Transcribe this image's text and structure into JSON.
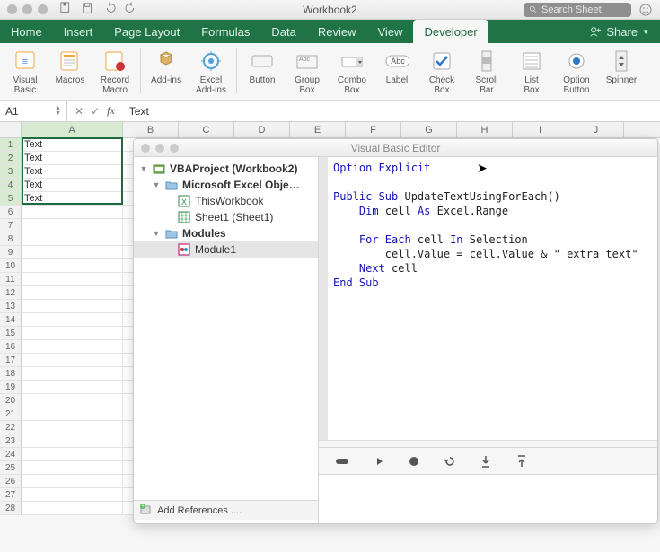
{
  "window": {
    "title": "Workbook2",
    "search_placeholder": "Search Sheet",
    "share_label": "Share"
  },
  "tabs": [
    {
      "label": "Home"
    },
    {
      "label": "Insert"
    },
    {
      "label": "Page Layout"
    },
    {
      "label": "Formulas"
    },
    {
      "label": "Data"
    },
    {
      "label": "Review"
    },
    {
      "label": "View"
    },
    {
      "label": "Developer",
      "active": true
    }
  ],
  "ribbon": {
    "visual_basic": "Visual\nBasic",
    "macros": "Macros",
    "record_macro": "Record\nMacro",
    "addins": "Add-ins",
    "excel_addins": "Excel\nAdd-ins",
    "button": "Button",
    "group_box": "Group\nBox",
    "combo_box": "Combo\nBox",
    "label": "Label",
    "check_box": "Check\nBox",
    "scroll_bar": "Scroll\nBar",
    "list_box": "List\nBox",
    "option_button": "Option\nButton",
    "spinner": "Spinner"
  },
  "formula_bar": {
    "name_box": "A1",
    "fx": "fx",
    "content": "Text"
  },
  "grid": {
    "columns": [
      "A",
      "B",
      "C",
      "D",
      "E",
      "F",
      "G",
      "H",
      "I",
      "J"
    ],
    "col_widths": {
      "A": 113
    },
    "rows": [
      {
        "n": 1,
        "cells": [
          "Text"
        ]
      },
      {
        "n": 2,
        "cells": [
          "Text"
        ]
      },
      {
        "n": 3,
        "cells": [
          "Text"
        ]
      },
      {
        "n": 4,
        "cells": [
          "Text"
        ]
      },
      {
        "n": 5,
        "cells": [
          "Text"
        ]
      },
      {
        "n": 6,
        "cells": [
          ""
        ]
      },
      {
        "n": 7,
        "cells": [
          ""
        ]
      },
      {
        "n": 8,
        "cells": [
          ""
        ]
      },
      {
        "n": 9,
        "cells": [
          ""
        ]
      },
      {
        "n": 10,
        "cells": [
          ""
        ]
      },
      {
        "n": 11,
        "cells": [
          ""
        ]
      },
      {
        "n": 12,
        "cells": [
          ""
        ]
      },
      {
        "n": 13,
        "cells": [
          ""
        ]
      },
      {
        "n": 14,
        "cells": [
          ""
        ]
      },
      {
        "n": 15,
        "cells": [
          ""
        ]
      },
      {
        "n": 16,
        "cells": [
          ""
        ]
      },
      {
        "n": 17,
        "cells": [
          ""
        ]
      },
      {
        "n": 18,
        "cells": [
          ""
        ]
      },
      {
        "n": 19,
        "cells": [
          ""
        ]
      },
      {
        "n": 20,
        "cells": [
          ""
        ]
      },
      {
        "n": 21,
        "cells": [
          ""
        ]
      },
      {
        "n": 22,
        "cells": [
          ""
        ]
      },
      {
        "n": 23,
        "cells": [
          ""
        ]
      },
      {
        "n": 24,
        "cells": [
          ""
        ]
      },
      {
        "n": 25,
        "cells": [
          ""
        ]
      },
      {
        "n": 26,
        "cells": [
          ""
        ]
      },
      {
        "n": 27,
        "cells": [
          ""
        ]
      },
      {
        "n": 28,
        "cells": [
          ""
        ]
      }
    ],
    "selection": {
      "col": "A",
      "rowStart": 1,
      "rowEnd": 5
    }
  },
  "vbe": {
    "title": "Visual Basic Editor",
    "project_root": "VBAProject (Workbook2)",
    "excel_objects": "Microsoft Excel Obje…",
    "this_workbook": "ThisWorkbook",
    "sheet1": "Sheet1 (Sheet1)",
    "modules": "Modules",
    "module1": "Module1",
    "add_references": "Add References ....",
    "code": {
      "l1a": "Option Explicit",
      "l3a": "Public Sub",
      "l3b": " UpdateTextUsingForEach()",
      "l4a": "Dim",
      "l4b": " cell ",
      "l4c": "As",
      "l4d": " Excel.Range",
      "l6a": "For Each",
      "l6b": " cell ",
      "l6c": "In",
      "l6d": " Selection",
      "l7a": "cell.Value = cell.Value & \" extra text\"",
      "l8a": "Next",
      "l8b": " cell",
      "l9a": "End Sub"
    }
  }
}
